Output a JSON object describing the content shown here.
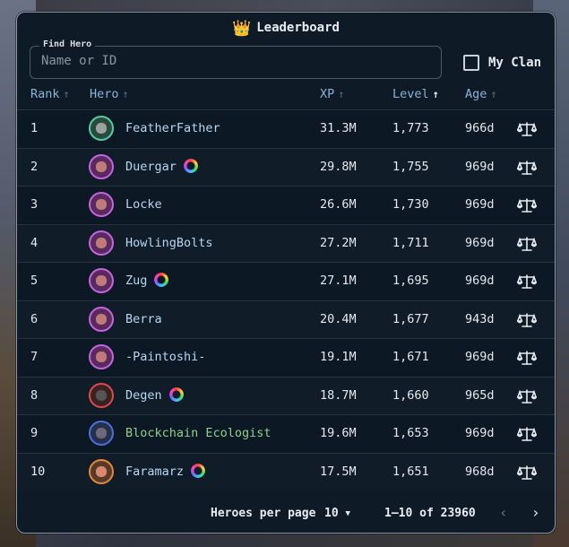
{
  "title": "Leaderboard",
  "search": {
    "legend": "Find Hero",
    "placeholder": "Name or ID",
    "value": ""
  },
  "clan_filter": {
    "label": "My Clan",
    "checked": false
  },
  "columns": [
    {
      "label": "Rank",
      "sort": "none"
    },
    {
      "label": "Hero",
      "sort": "none"
    },
    {
      "label": "XP",
      "sort": "none"
    },
    {
      "label": "Level",
      "sort": "asc-active"
    },
    {
      "label": "Age",
      "sort": "none"
    }
  ],
  "rows": [
    {
      "rank": "1",
      "hero": "FeatherFather",
      "xp": "31.3M",
      "level": "1,773",
      "age": "966d",
      "avatar": "green",
      "badge": false,
      "name_color": "default"
    },
    {
      "rank": "2",
      "hero": "Duergar",
      "xp": "29.8M",
      "level": "1,755",
      "age": "969d",
      "avatar": "purple",
      "badge": true,
      "name_color": "default"
    },
    {
      "rank": "3",
      "hero": "Locke",
      "xp": "26.6M",
      "level": "1,730",
      "age": "969d",
      "avatar": "purple",
      "badge": false,
      "name_color": "default"
    },
    {
      "rank": "4",
      "hero": "HowlingBolts",
      "xp": "27.2M",
      "level": "1,711",
      "age": "969d",
      "avatar": "purple",
      "badge": false,
      "name_color": "default"
    },
    {
      "rank": "5",
      "hero": "Zug",
      "xp": "27.1M",
      "level": "1,695",
      "age": "969d",
      "avatar": "purple",
      "badge": true,
      "name_color": "default"
    },
    {
      "rank": "6",
      "hero": "Berra",
      "xp": "20.4M",
      "level": "1,677",
      "age": "943d",
      "avatar": "purple",
      "badge": false,
      "name_color": "default"
    },
    {
      "rank": "7",
      "hero": "-Paintoshi-",
      "xp": "19.1M",
      "level": "1,671",
      "age": "969d",
      "avatar": "purple",
      "badge": false,
      "name_color": "default"
    },
    {
      "rank": "8",
      "hero": "Degen",
      "xp": "18.7M",
      "level": "1,660",
      "age": "965d",
      "avatar": "red",
      "badge": true,
      "name_color": "default"
    },
    {
      "rank": "9",
      "hero": "Blockchain Ecologist",
      "xp": "19.6M",
      "level": "1,653",
      "age": "969d",
      "avatar": "blue",
      "badge": false,
      "name_color": "green"
    },
    {
      "rank": "10",
      "hero": "Faramarz",
      "xp": "17.5M",
      "level": "1,651",
      "age": "968d",
      "avatar": "orange",
      "badge": true,
      "name_color": "default"
    }
  ],
  "pagination": {
    "per_page_label": "Heroes per page",
    "per_page_value": "10",
    "range": "1–10 of 23960"
  },
  "icons": {
    "title": "crown-icon",
    "row_action": "scale-icon",
    "prev": "chevron-left-icon",
    "next": "chevron-right-icon"
  }
}
